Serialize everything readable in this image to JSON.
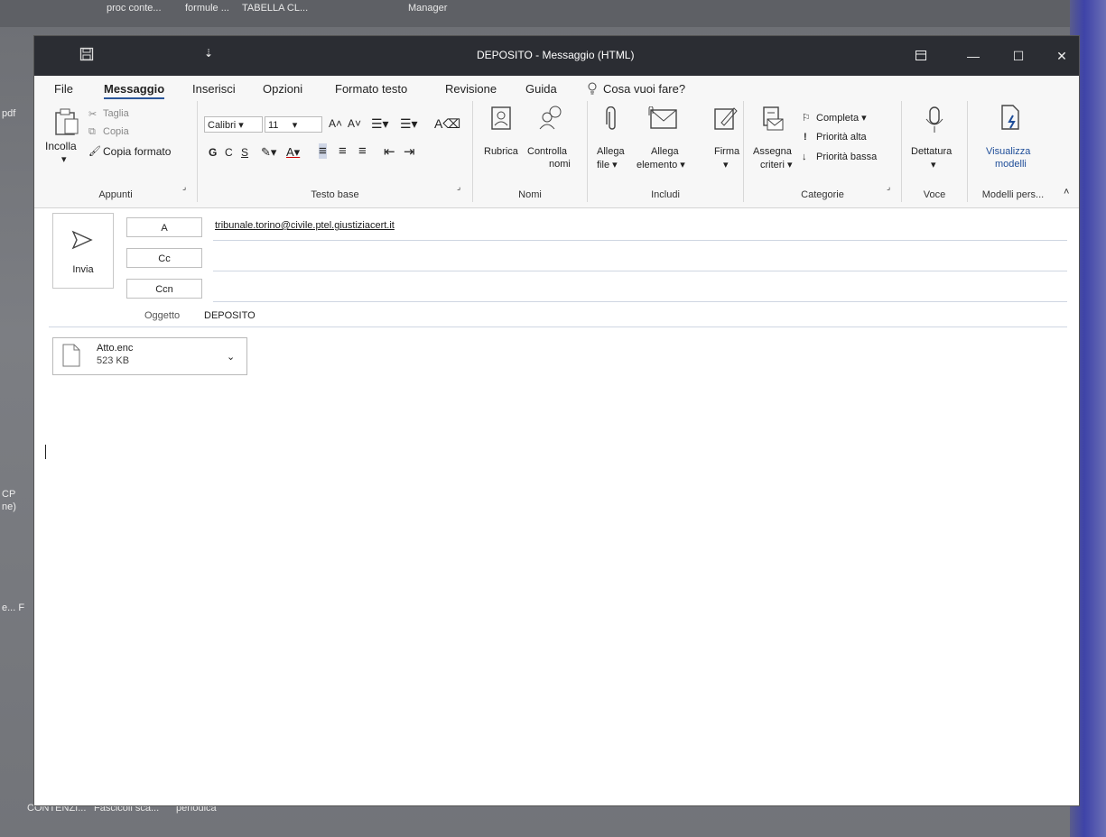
{
  "desktop": {
    "top_items": [
      "proc conte...",
      "formule ...",
      "TABELLA CL...",
      "Manager"
    ],
    "left_items": [
      "pdf",
      "CP",
      "ne)",
      "e... F"
    ],
    "bottom_items": [
      "CONTENZI...",
      "Fascicoli sca...",
      "periodica"
    ]
  },
  "window": {
    "title": "DEPOSITO  -  Messaggio (HTML)",
    "quick_access": "⇣"
  },
  "menu": {
    "file": "File",
    "messaggio": "Messaggio",
    "inserisci": "Inserisci",
    "opzioni": "Opzioni",
    "formato": "Formato testo",
    "revisione": "Revisione",
    "guida": "Guida",
    "search": "Cosa vuoi fare?"
  },
  "ribbon": {
    "appunti": {
      "label": "Appunti",
      "incolla": "Incolla",
      "taglia": "Taglia",
      "copia": "Copia",
      "copia_formato": "Copia formato"
    },
    "testo_base": {
      "label": "Testo base",
      "font": "Calibri",
      "size": "11",
      "bold": "G",
      "italic": "C",
      "underline": "S"
    },
    "nomi": {
      "label": "Nomi",
      "rubrica": "Rubrica",
      "controlla": "Controlla",
      "controlla2": "nomi"
    },
    "includi": {
      "label": "Includi",
      "allega_file": "Allega",
      "allega_file2": "file ▾",
      "allega_elem": "Allega",
      "allega_elem2": "elemento ▾",
      "firma": "Firma"
    },
    "categorie": {
      "label": "Categorie",
      "assegna": "Assegna",
      "assegna2": "criteri ▾",
      "completa": "Completa ▾",
      "alta": "Priorità alta",
      "bassa": "Priorità bassa"
    },
    "voce": {
      "label": "Voce",
      "dettatura": "Dettatura"
    },
    "modelli": {
      "label": "Modelli pers...",
      "visualizza": "Visualizza",
      "visualizza2": "modelli"
    }
  },
  "compose": {
    "send": "Invia",
    "to_label": "A",
    "cc_label": "Cc",
    "bcc_label": "Ccn",
    "to_value": "tribunale.torino@civile.ptel.giustiziacert.it",
    "subject_label": "Oggetto",
    "subject_value": "DEPOSITO"
  },
  "attachment": {
    "name": "Atto.enc",
    "size": "523 KB"
  }
}
